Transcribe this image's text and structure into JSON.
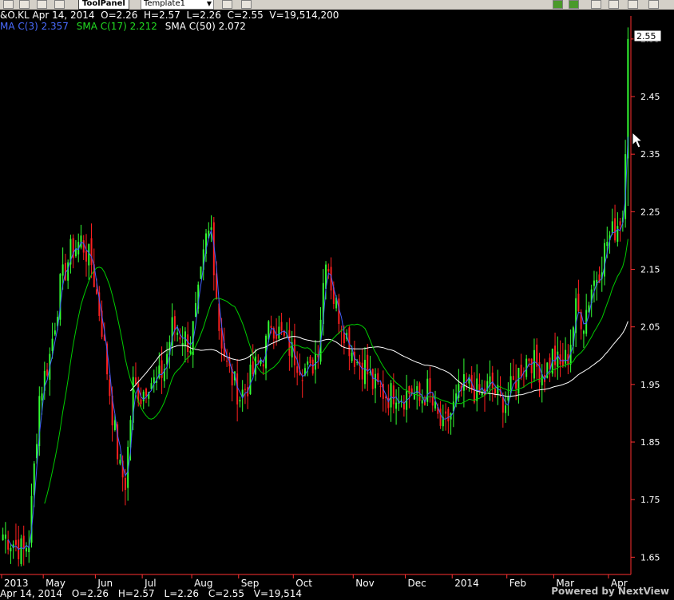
{
  "toolbar": {
    "toolpanel_label": "ToolPanel",
    "template_label": "Template1"
  },
  "header": {
    "symbol": "&O.KL",
    "date": "Apr 14, 2014",
    "open": "O=2.26",
    "high": "H=2.57",
    "low": "L=2.26",
    "close": "C=2.55",
    "volume": "V=19,514,200",
    "ma_fast": "MA C(3) 2.357",
    "sma_mid": "SMA C(17) 2.212",
    "sma_slow": "SMA C(50) 2.072"
  },
  "footer": {
    "date": "Apr 14, 2014",
    "open": "O=2.26",
    "high": "H=2.57",
    "low": "L=2.26",
    "close": "C=2.55",
    "volume": "V=19,514"
  },
  "watermark": "Powered by NextView",
  "colors": {
    "background": "#000000",
    "up": "#33ff33",
    "down": "#ff2020",
    "ma_fast": "#4060ff",
    "sma_mid": "#00cc00",
    "sma_slow": "#ffffff",
    "axis": "#ff3030",
    "header_ma": "#4a6cff",
    "header_sma": "#22dd22"
  },
  "chart_data": {
    "type": "candlestick",
    "ylim": [
      1.62,
      2.59
    ],
    "y_ticks": [
      "2.55",
      "2.45",
      "2.35",
      "2.25",
      "2.15",
      "2.05",
      "1.95",
      "1.85",
      "1.75",
      "1.65"
    ],
    "last_price_label": "2.55",
    "x_labels": [
      "2013",
      "May",
      "Jun",
      "Jul",
      "Aug",
      "Sep",
      "Oct",
      "Nov",
      "Dec",
      "2014",
      "Feb",
      "Mar",
      "Apr"
    ],
    "x_label_positions": [
      0,
      16,
      36,
      54,
      73,
      91,
      112,
      135,
      155,
      173,
      194,
      212,
      233
    ],
    "bar_count": 241,
    "close_anchors": [
      [
        0,
        1.69
      ],
      [
        8,
        1.66
      ],
      [
        10,
        1.68
      ],
      [
        14,
        1.93
      ],
      [
        18,
        2.0
      ],
      [
        22,
        2.12
      ],
      [
        26,
        2.18
      ],
      [
        30,
        2.2
      ],
      [
        34,
        2.16
      ],
      [
        38,
        2.05
      ],
      [
        42,
        1.9
      ],
      [
        45,
        1.8
      ],
      [
        47,
        1.78
      ],
      [
        50,
        1.95
      ],
      [
        53,
        1.93
      ],
      [
        56,
        1.96
      ],
      [
        59,
        1.95
      ],
      [
        62,
        1.98
      ],
      [
        65,
        2.05
      ],
      [
        68,
        2.04
      ],
      [
        72,
        2.02
      ],
      [
        75,
        2.1
      ],
      [
        78,
        2.2
      ],
      [
        80,
        2.22
      ],
      [
        83,
        2.05
      ],
      [
        86,
        1.98
      ],
      [
        89,
        1.95
      ],
      [
        91,
        1.93
      ],
      [
        94,
        1.95
      ],
      [
        97,
        1.98
      ],
      [
        100,
        2.0
      ],
      [
        103,
        2.06
      ],
      [
        106,
        2.04
      ],
      [
        109,
        2.02
      ],
      [
        112,
        2.0
      ],
      [
        115,
        1.98
      ],
      [
        118,
        1.97
      ],
      [
        121,
        2.02
      ],
      [
        124,
        2.18
      ],
      [
        127,
        2.1
      ],
      [
        130,
        2.06
      ],
      [
        133,
        2.02
      ],
      [
        136,
        1.99
      ],
      [
        139,
        1.98
      ],
      [
        142,
        1.95
      ],
      [
        145,
        1.94
      ],
      [
        148,
        1.93
      ],
      [
        151,
        1.94
      ],
      [
        154,
        1.93
      ],
      [
        157,
        1.94
      ],
      [
        160,
        1.92
      ],
      [
        163,
        1.94
      ],
      [
        166,
        1.9
      ],
      [
        169,
        1.87
      ],
      [
        172,
        1.9
      ],
      [
        175,
        1.93
      ],
      [
        178,
        1.95
      ],
      [
        181,
        1.94
      ],
      [
        184,
        1.93
      ],
      [
        187,
        1.95
      ],
      [
        190,
        1.93
      ],
      [
        193,
        1.92
      ],
      [
        196,
        1.95
      ],
      [
        199,
        1.98
      ],
      [
        202,
        2.0
      ],
      [
        205,
        1.98
      ],
      [
        208,
        1.97
      ],
      [
        211,
        2.0
      ],
      [
        214,
        1.98
      ],
      [
        217,
        2.0
      ],
      [
        220,
        2.08
      ],
      [
        223,
        2.06
      ],
      [
        226,
        2.12
      ],
      [
        229,
        2.15
      ],
      [
        232,
        2.2
      ],
      [
        235,
        2.22
      ],
      [
        237,
        2.24
      ],
      [
        238,
        2.24
      ],
      [
        239,
        2.35
      ],
      [
        240,
        2.55
      ]
    ],
    "series": [
      {
        "name": "MA C(3)",
        "last": 2.357
      },
      {
        "name": "SMA C(17)",
        "last": 2.212
      },
      {
        "name": "SMA C(50)",
        "last": 2.072
      }
    ]
  }
}
